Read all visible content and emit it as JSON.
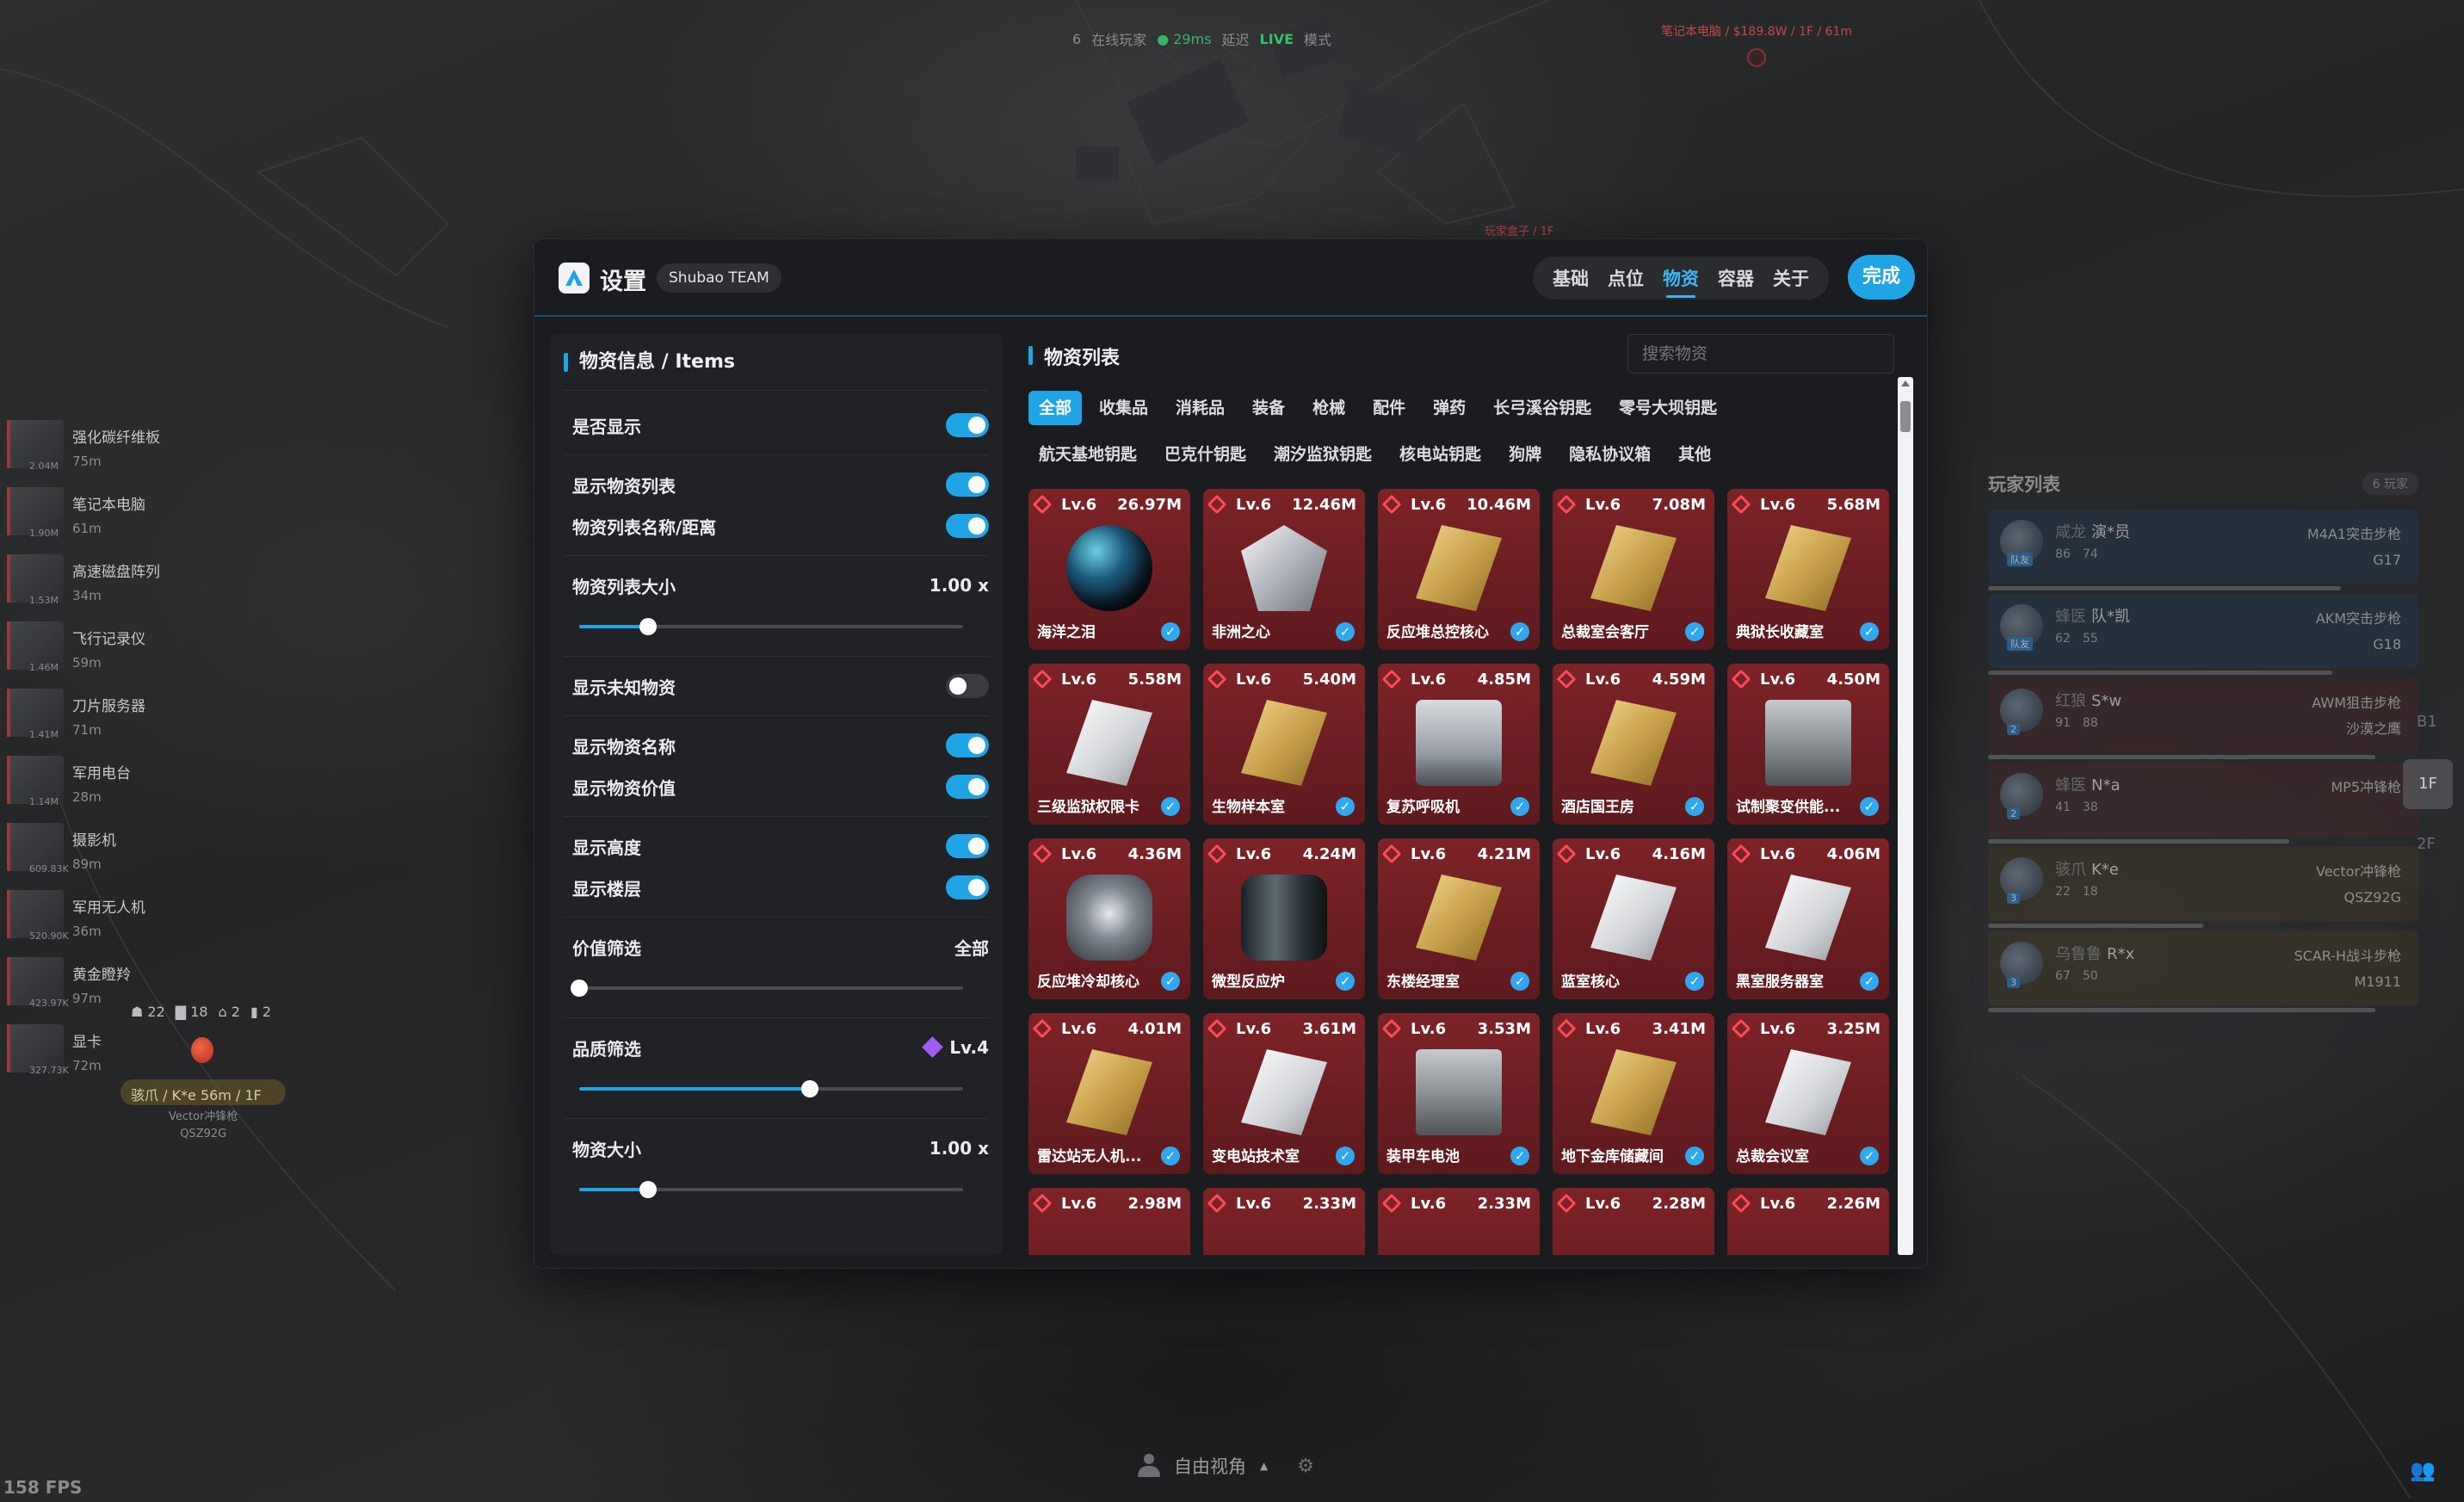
{
  "hud": {
    "online_count": "6",
    "online_label": "在线玩家",
    "ping": "● 29ms",
    "latency_label": "延迟",
    "mode_value": "LIVE",
    "mode_label": "模式",
    "top_marker": "笔记本电脑 / $189.8W / 1F / 61m",
    "map_small_label": "玩家盒子 / 1F",
    "fps": "158 FPS",
    "bottom_view": "自由视角",
    "bottom_caret": "▲"
  },
  "left_map_items": [
    {
      "name": "强化碳纤维板",
      "dist": "75m",
      "value": "2.04M"
    },
    {
      "name": "笔记本电脑",
      "dist": "61m",
      "value": "1.90M"
    },
    {
      "name": "高速磁盘阵列",
      "dist": "34m",
      "value": "1.53M"
    },
    {
      "name": "飞行记录仪",
      "dist": "59m",
      "value": "1.46M"
    },
    {
      "name": "刀片服务器",
      "dist": "71m",
      "value": "1.41M"
    },
    {
      "name": "军用电台",
      "dist": "28m",
      "value": "1.14M"
    },
    {
      "name": "摄影机",
      "dist": "89m",
      "value": "609.83K"
    },
    {
      "name": "军用无人机",
      "dist": "36m",
      "value": "520.90K"
    },
    {
      "name": "黄金瞪羚",
      "dist": "97m",
      "value": "423.97K"
    },
    {
      "name": "显卡",
      "dist": "72m",
      "value": "327.73K"
    }
  ],
  "left_stats": [
    "☗ 22",
    "▇ 18",
    "⌂ 2",
    "▮ 2"
  ],
  "left_player": {
    "tag": "骇爪 / K*e 56m / 1F",
    "weapon": "Vector冲锋枪",
    "secondary": "QSZ92G"
  },
  "player_panel": {
    "title": "玩家列表",
    "count": "6 玩家",
    "players": [
      {
        "tag": "咸龙",
        "name": "演*员",
        "s1": "86",
        "s2": "74",
        "weapon": "M4A1突击步枪",
        "sub": "G17",
        "style": "team",
        "badge": "队友",
        "hp": 0.82
      },
      {
        "tag": "蜂医",
        "name": "队*凯",
        "s1": "62",
        "s2": "55",
        "weapon": "AKM突击步枪",
        "sub": "G18",
        "style": "team",
        "badge": "队友",
        "hp": 0.8
      },
      {
        "tag": "红狼",
        "name": "S*w",
        "s1": "91",
        "s2": "88",
        "weapon": "AWM狙击步枪",
        "sub": "沙漠之鹰",
        "style": "red",
        "badge": "2",
        "hp": 0.9
      },
      {
        "tag": "蜂医",
        "name": "N*a",
        "s1": "41",
        "s2": "38",
        "weapon": "MP5冲锋枪",
        "sub": "",
        "style": "red",
        "badge": "2",
        "hp": 0.7
      },
      {
        "tag": "骇爪",
        "name": "K*e",
        "s1": "22",
        "s2": "18",
        "weapon": "Vector冲锋枪",
        "sub": "QSZ92G",
        "style": "yellow",
        "badge": "3",
        "hp": 0.5
      },
      {
        "tag": "乌鲁鲁",
        "name": "R*x",
        "s1": "67",
        "s2": "50",
        "weapon": "SCAR-H战斗步枪",
        "sub": "M1911",
        "style": "yellow",
        "badge": "3",
        "hp": 0.9
      }
    ],
    "floor_badge": "1F",
    "side_nums": [
      "B1",
      "2F"
    ]
  },
  "modal": {
    "title": "设置",
    "team": "Shubao TEAM",
    "tabs": [
      "基础",
      "点位",
      "物资",
      "容器",
      "关于"
    ],
    "active_tab": 2,
    "done": "完成"
  },
  "settings": {
    "title": "物资信息 / Items",
    "show": "是否显示",
    "show_list": "显示物资列表",
    "list_name_dist": "物资列表名称/距离",
    "list_size_label": "物资列表大小",
    "list_size_value": "1.00 x",
    "list_size_level": 0.18,
    "show_unknown": "显示未知物资",
    "show_name": "显示物资名称",
    "show_value": "显示物资价值",
    "show_height": "显示高度",
    "show_floor": "显示楼层",
    "value_filter_label": "价值筛选",
    "value_filter_value": "全部",
    "value_filter_level": 0.0,
    "quality_filter_label": "品质筛选",
    "quality_filter_value": "Lv.4",
    "quality_filter_level": 0.6,
    "item_size_label": "物资大小",
    "item_size_value": "1.00 x",
    "item_size_level": 0.18
  },
  "items_panel": {
    "title": "物资列表",
    "search_placeholder": "搜索物资",
    "cats_row1": [
      "全部",
      "收集品",
      "消耗品",
      "装备",
      "枪械",
      "配件",
      "弹药",
      "长弓溪谷钥匙",
      "零号大坝钥匙"
    ],
    "cats_row2": [
      "航天基地钥匙",
      "巴克什钥匙",
      "潮汐监狱钥匙",
      "核电站钥匙",
      "狗牌",
      "隐私协议箱",
      "其他"
    ],
    "active_cat": "全部",
    "items": [
      {
        "lv": "Lv.6",
        "price": "26.97M",
        "name": "海洋之泪",
        "art": "orb"
      },
      {
        "lv": "Lv.6",
        "price": "12.46M",
        "name": "非洲之心",
        "art": "gem"
      },
      {
        "lv": "Lv.6",
        "price": "10.46M",
        "name": "反应堆总控核心",
        "art": "card-gold"
      },
      {
        "lv": "Lv.6",
        "price": "7.08M",
        "name": "总裁室会客厅",
        "art": "card-gold"
      },
      {
        "lv": "Lv.6",
        "price": "5.68M",
        "name": "典狱长收藏室",
        "art": "card-gold"
      },
      {
        "lv": "Lv.6",
        "price": "5.58M",
        "name": "三级监狱权限卡",
        "art": "card-white"
      },
      {
        "lv": "Lv.6",
        "price": "5.40M",
        "name": "生物样本室",
        "art": "card-gold"
      },
      {
        "lv": "Lv.6",
        "price": "4.85M",
        "name": "复苏呼吸机",
        "art": "device"
      },
      {
        "lv": "Lv.6",
        "price": "4.59M",
        "name": "酒店国王房",
        "art": "card-gold"
      },
      {
        "lv": "Lv.6",
        "price": "4.50M",
        "name": "试制聚变供能...",
        "art": "box"
      },
      {
        "lv": "Lv.6",
        "price": "4.36M",
        "name": "反应堆冷却核心",
        "art": "machine"
      },
      {
        "lv": "Lv.6",
        "price": "4.24M",
        "name": "微型反应炉",
        "art": "reactor"
      },
      {
        "lv": "Lv.6",
        "price": "4.21M",
        "name": "东楼经理室",
        "art": "card-gold"
      },
      {
        "lv": "Lv.6",
        "price": "4.16M",
        "name": "蓝室核心",
        "art": "card-white"
      },
      {
        "lv": "Lv.6",
        "price": "4.06M",
        "name": "黑室服务器室",
        "art": "card-white"
      },
      {
        "lv": "Lv.6",
        "price": "4.01M",
        "name": "雷达站无人机...",
        "art": "card-gold"
      },
      {
        "lv": "Lv.6",
        "price": "3.61M",
        "name": "变电站技术室",
        "art": "card-white"
      },
      {
        "lv": "Lv.6",
        "price": "3.53M",
        "name": "装甲车电池",
        "art": "box"
      },
      {
        "lv": "Lv.6",
        "price": "3.41M",
        "name": "地下金库储藏间",
        "art": "card-gold"
      },
      {
        "lv": "Lv.6",
        "price": "3.25M",
        "name": "总裁会议室",
        "art": "card-white"
      },
      {
        "lv": "Lv.6",
        "price": "2.98M",
        "name": "",
        "art": "partial"
      },
      {
        "lv": "Lv.6",
        "price": "2.33M",
        "name": "",
        "art": "partial"
      },
      {
        "lv": "Lv.6",
        "price": "2.33M",
        "name": "",
        "art": "partial"
      },
      {
        "lv": "Lv.6",
        "price": "2.28M",
        "name": "",
        "art": "partial-gold"
      },
      {
        "lv": "Lv.6",
        "price": "2.26M",
        "name": "",
        "art": "partial-gold"
      }
    ]
  },
  "colors": {
    "accent": "#1fa4e6",
    "card_bg": "#7d2327",
    "panel_bg": "#1b1c1f"
  }
}
